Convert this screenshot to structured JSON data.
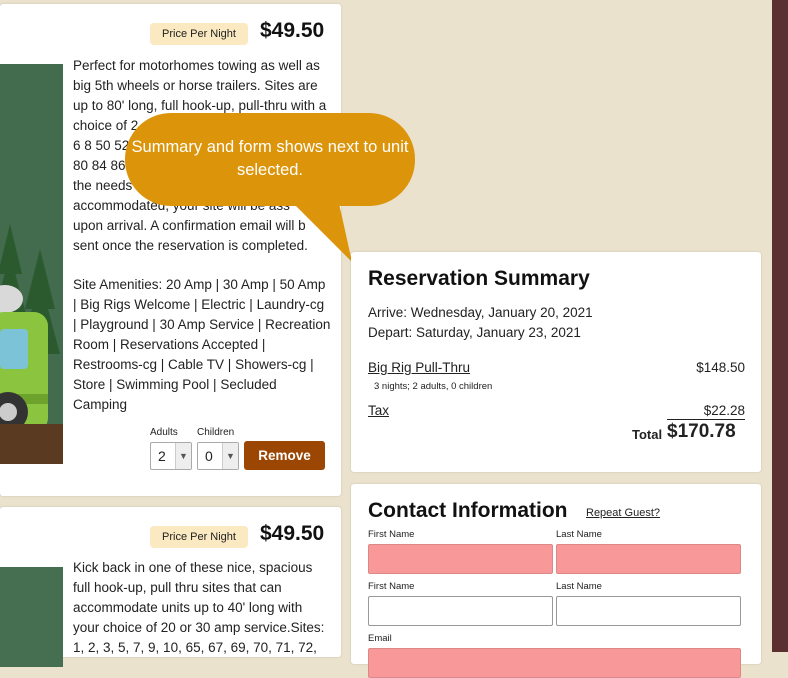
{
  "units": [
    {
      "price_label": "Price Per Night",
      "price": "$49.50",
      "description": "Perfect for motorhomes towing as well as big 5th wheels or horse trailers. Sites are up to 80' long, full hook-up, pull-thru with a choice of 2",
      "desc_line_b": "6 8 50 52",
      "desc_line_c": "80 84 86",
      "desc_line_d": "the needs o",
      "desc_line_e": "accommodated, your site will be ass",
      "desc_line_f": "upon arrival. A confirmation email will b",
      "desc_line_g": "sent once the reservation is completed.",
      "amenities": "Site Amenities: 20 Amp | 30 Amp | 50 Amp | Big Rigs Welcome | Electric | Laundry-cg | Playground | 30 Amp Service | Recreation Room | Reservations Accepted | Restrooms-cg | Cable TV | Showers-cg | Store | Swimming Pool | Secluded Camping",
      "adults_label": "Adults",
      "children_label": "Children",
      "adults_value": "2",
      "children_value": "0",
      "remove_label": "Remove"
    },
    {
      "price_label": "Price Per Night",
      "price": "$49.50",
      "description": "Kick back in one of these nice, spacious full hook-up, pull thru sites that can accommodate units up to 40' long with your choice of 20 or 30 amp service.Sites: 1, 2, 3, 5, 7, 9, 10, 65, 67, 69, 70, 71, 72,"
    }
  ],
  "callout": {
    "text": "Summary and form shows next to unit selected."
  },
  "summary": {
    "title": "Reservation Summary",
    "arrive": "Arrive: Wednesday, January 20, 2021",
    "depart": "Depart: Saturday, January 23, 2021",
    "item_label": "Big Rig Pull-Thru",
    "item_amount": "$148.50",
    "item_note": "3 nights; 2 adults, 0 children",
    "tax_label": "Tax",
    "tax_amount": "$22.28",
    "total_label": "Total",
    "total_amount": "$170.78"
  },
  "contact": {
    "title": "Contact Information",
    "repeat_link": "Repeat Guest?",
    "fields": [
      {
        "label": "First Name"
      },
      {
        "label": "Last Name"
      },
      {
        "label": "First Name"
      },
      {
        "label": "Last Name"
      },
      {
        "label": "Email"
      }
    ]
  },
  "colors": {
    "page_bg": "#ebe2cd",
    "accent_remove": "#9c4603",
    "callout": "#dc950a",
    "invalid_field": "#f89898",
    "price_badge": "#fae9c1",
    "side_border": "#5c2f31"
  }
}
